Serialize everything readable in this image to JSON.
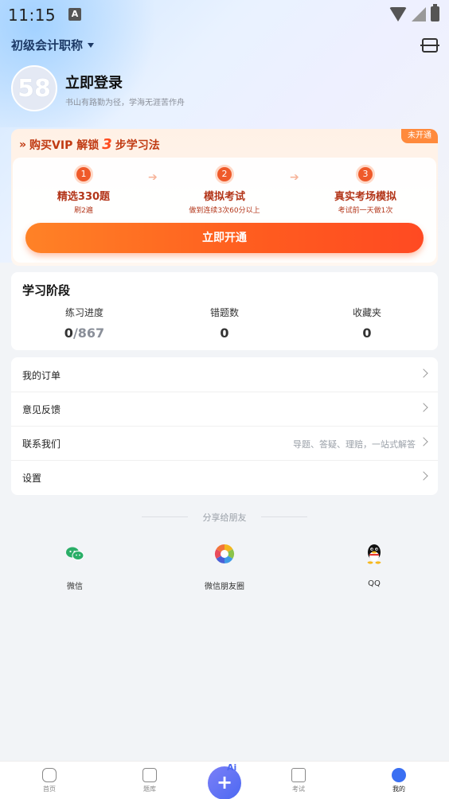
{
  "status_bar": {
    "time": "11:15",
    "a_badge": "A"
  },
  "header": {
    "course": "初级会计职称"
  },
  "profile": {
    "avatar_text": "58",
    "title": "立即登录",
    "subtitle": "书山有路勤为径，学海无涯苦作舟"
  },
  "vip": {
    "prefix": "购买VIP 解锁",
    "steps_count": "3",
    "suffix": "步学习法",
    "badge": "未开通",
    "steps": [
      {
        "num": "1",
        "title": "精选330题",
        "sub": "刷2遍"
      },
      {
        "num": "2",
        "title": "模拟考试",
        "sub": "做到连续3次60分以上"
      },
      {
        "num": "3",
        "title": "真实考场模拟",
        "sub": "考试前一天做1次"
      }
    ],
    "button": "立即开通"
  },
  "stage": {
    "title": "学习阶段",
    "stats": [
      {
        "label": "练习进度",
        "value": "0",
        "total": "/867"
      },
      {
        "label": "错题数",
        "value": "0"
      },
      {
        "label": "收藏夹",
        "value": "0"
      }
    ]
  },
  "menu": [
    {
      "label": "我的订单",
      "note": ""
    },
    {
      "label": "意见反馈",
      "note": ""
    },
    {
      "label": "联系我们",
      "note": "导题、答疑、理赔，一站式解答"
    },
    {
      "label": "设置",
      "note": ""
    }
  ],
  "share": {
    "title": "分享给朋友",
    "items": [
      {
        "label": "微信",
        "icon": "wechat-icon"
      },
      {
        "label": "微信朋友圈",
        "icon": "moments-icon"
      },
      {
        "label": "QQ",
        "icon": "qq-icon"
      }
    ]
  },
  "tabs": [
    {
      "label": "首页",
      "icon": "home-icon"
    },
    {
      "label": "题库",
      "icon": "question-bank-icon"
    },
    {
      "label": "考试",
      "icon": "exam-icon"
    },
    {
      "label": "我的",
      "icon": "profile-icon"
    }
  ],
  "fab": {
    "plus": "+",
    "ai": "Ai"
  },
  "colors": {
    "accent": "#3a6ff2",
    "vip_orange": "#ff5b1f",
    "vip_text": "#b3361a"
  }
}
